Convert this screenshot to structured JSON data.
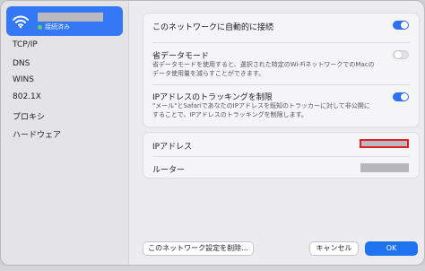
{
  "sidebar": {
    "network": {
      "status": "接続済み",
      "icon": "wifi-icon"
    },
    "items": [
      {
        "label": "TCP/IP"
      },
      {
        "label": "DNS"
      },
      {
        "label": "WINS"
      },
      {
        "label": "802.1X"
      },
      {
        "label": "プロキシ"
      },
      {
        "label": "ハードウェア"
      }
    ]
  },
  "settings": {
    "auto_join": {
      "label": "このネットワークに自動的に接続",
      "enabled": true
    },
    "low_data": {
      "label": "省データモード",
      "description_line1": "省データモードを使用すると、選択された特定のWi-FiネットワークでのMacの",
      "description_line2": "データ使用量を減らすことができます。",
      "enabled": false
    },
    "limit_ip_tracking": {
      "label": "IPアドレスのトラッキングを制限",
      "description_line1": "\"メール\"とSafariであなたのIPアドレスを既知のトラッカーに対して非公開に",
      "description_line2": "することで、IPアドレスのトラッキングを制限します。",
      "enabled": true
    }
  },
  "info": {
    "ip_address_label": "IPアドレス",
    "router_label": "ルーター"
  },
  "footer": {
    "forget_label": "このネットワーク設定を削除...",
    "cancel_label": "キャンセル",
    "ok_label": "OK"
  },
  "colors": {
    "accent": "#2f6ff4",
    "redaction_outline": "#e01f26"
  }
}
